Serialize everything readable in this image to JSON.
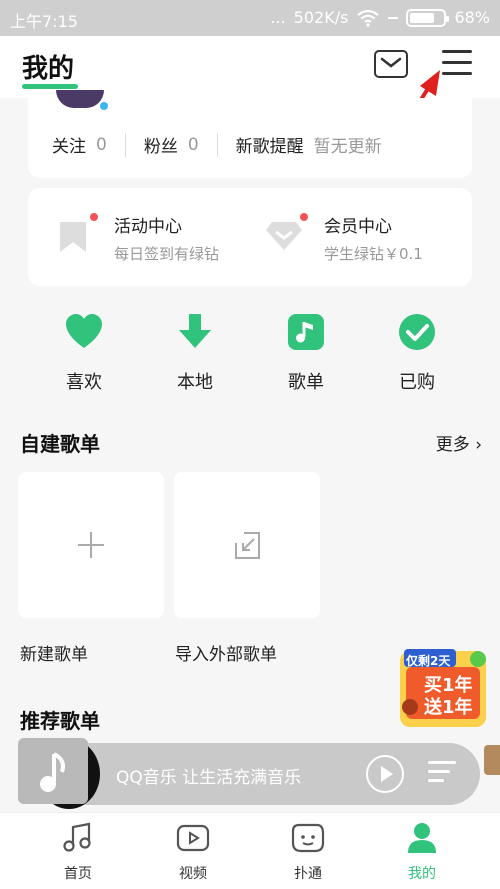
{
  "status_bar": {
    "time": "上午7:15",
    "dots": "...",
    "speed": "502K/s",
    "battery": "68%"
  },
  "header": {
    "title": "我的"
  },
  "profile": {
    "follow_label": "关注",
    "follow_count": "0",
    "fans_label": "粉丝",
    "fans_count": "0",
    "newsong_label": "新歌提醒",
    "newsong_status": "暂无更新"
  },
  "activities": [
    {
      "title": "活动中心",
      "subtitle": "每日签到有绿钻",
      "icon": "bookmark-icon"
    },
    {
      "title": "会员中心",
      "subtitle": "学生绿钻￥0.1",
      "icon": "diamond-icon"
    }
  ],
  "quick_actions": [
    {
      "label": "喜欢",
      "icon": "heart-icon"
    },
    {
      "label": "本地",
      "icon": "download-arrow-icon"
    },
    {
      "label": "歌单",
      "icon": "music-note-icon"
    },
    {
      "label": "已购",
      "icon": "check-circle-icon"
    }
  ],
  "playlists": {
    "title": "自建歌单",
    "more_label": "更多",
    "items": [
      {
        "label": "新建歌单",
        "icon": "plus-icon"
      },
      {
        "label": "导入外部歌单",
        "icon": "import-icon"
      }
    ]
  },
  "recommended": {
    "title": "推荐歌单"
  },
  "promo": {
    "line1": "仅剩2天",
    "line2": "买1年",
    "line3": "送1年"
  },
  "mini_player": {
    "text": "QQ音乐 让生活充满音乐"
  },
  "tabs": [
    {
      "label": "首页",
      "icon": "music-note-tab-icon"
    },
    {
      "label": "视频",
      "icon": "video-play-icon"
    },
    {
      "label": "扑通",
      "icon": "chat-face-icon"
    },
    {
      "label": "我的",
      "icon": "profile-icon",
      "active": true
    }
  ],
  "colors": {
    "accent": "#31c27c",
    "background": "#f6f6f6",
    "annotation_arrow": "#e0201c"
  }
}
